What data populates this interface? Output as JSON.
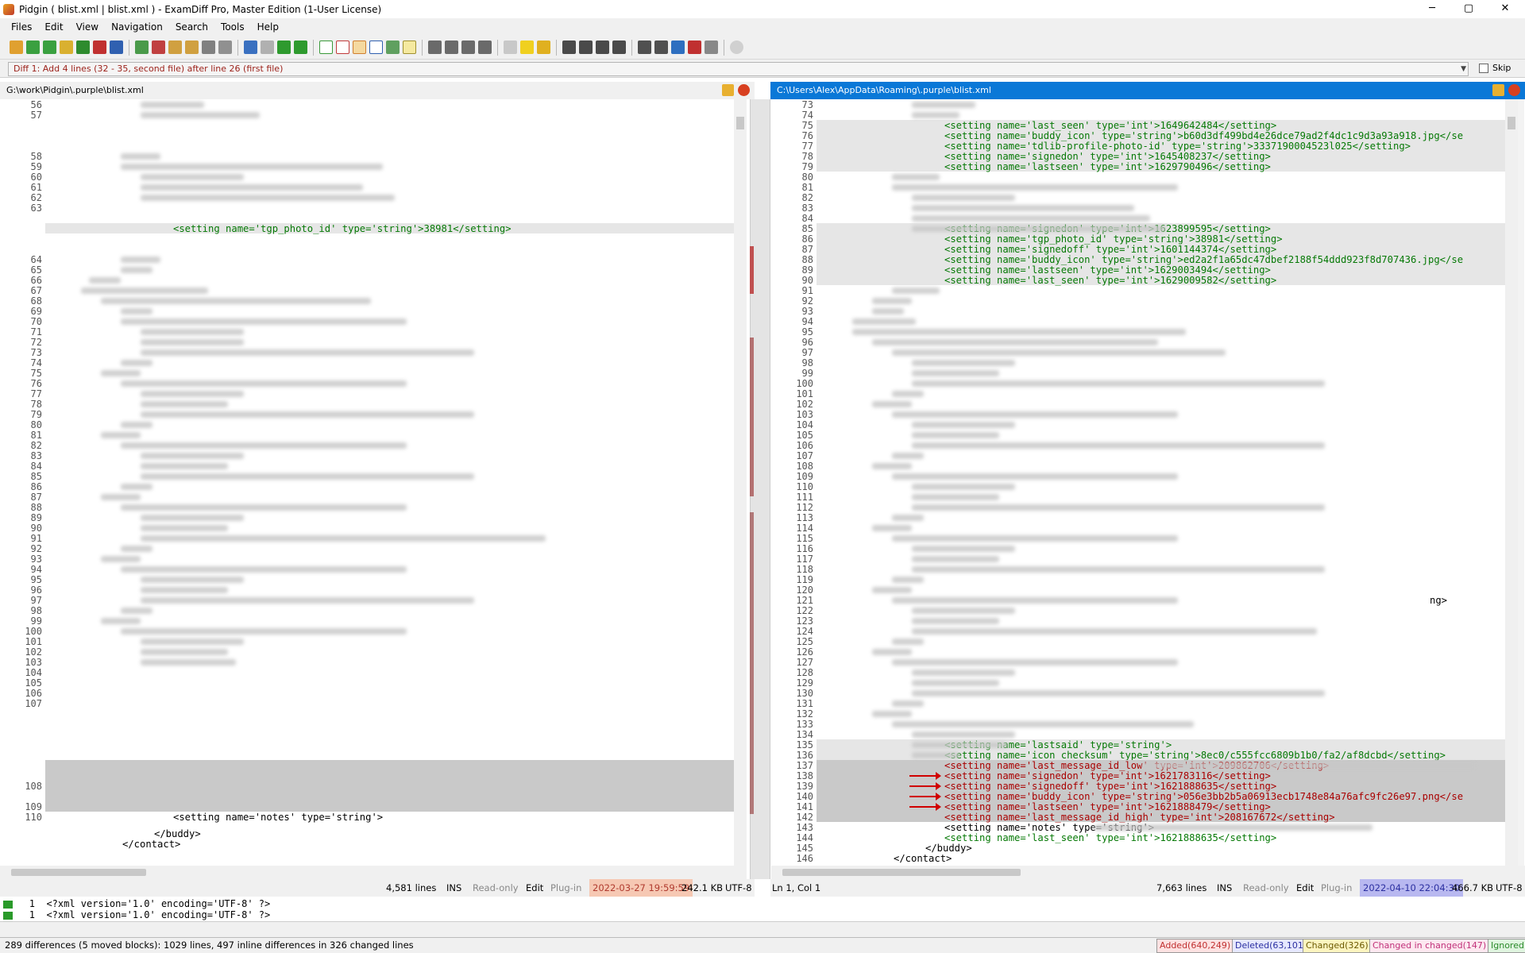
{
  "window": {
    "title": "Pidgin ( blist.xml  |  blist.xml ) - ExamDiff Pro, Master Edition (1-User License)",
    "controls": [
      "─",
      "▢",
      "✕"
    ]
  },
  "menu": [
    "Files",
    "Edit",
    "View",
    "Navigation",
    "Search",
    "Tools",
    "Help"
  ],
  "diffbar": {
    "current": "Diff 1: Add 4 lines (32 - 35, second file) after line 26 (first file)",
    "skip_label": "Skip"
  },
  "left": {
    "path": "G:\\work\\Pidgin\\.purple\\blist.xml",
    "numbers": [
      "56",
      "57",
      "",
      "",
      "",
      "58",
      "59",
      "60",
      "61",
      "62",
      "63",
      "",
      "",
      "",
      "",
      "64",
      "65",
      "66",
      "67",
      "68",
      "69",
      "70",
      "71",
      "72",
      "73",
      "74",
      "75",
      "76",
      "77",
      "78",
      "79",
      "80",
      "81",
      "82",
      "83",
      "84",
      "85",
      "86",
      "87",
      "88",
      "89",
      "90",
      "91",
      "92",
      "93",
      "94",
      "95",
      "96",
      "97",
      "98",
      "99",
      "100",
      "101",
      "102",
      "103",
      "104",
      "105",
      "106",
      "107",
      "",
      "",
      "",
      "",
      "",
      "",
      "",
      "108",
      "",
      "109",
      "110"
    ],
    "line63": "<setting name='tgp_photo_id' type='string'>38981</setting>",
    "line108": "<setting name='notes' type='string'>",
    "line109": "</buddy>",
    "line110": "</contact>",
    "status": {
      "lines": "4,581 lines",
      "ins": "INS",
      "ro": "Read-only",
      "edit": "Edit",
      "plugin": "Plug-in",
      "date": "2022-03-27 19:59:59",
      "size": "242.1 KB",
      "enc": "UTF-8"
    }
  },
  "right": {
    "path": "C:\\Users\\Alex\\AppData\\Roaming\\.purple\\blist.xml",
    "numbers": [
      "73",
      "74",
      "75",
      "76",
      "77",
      "78",
      "79",
      "80",
      "81",
      "82",
      "83",
      "84",
      "85",
      "86",
      "87",
      "88",
      "89",
      "90",
      "91",
      "92",
      "93",
      "94",
      "95",
      "96",
      "97",
      "98",
      "99",
      "100",
      "101",
      "102",
      "103",
      "104",
      "105",
      "106",
      "107",
      "108",
      "109",
      "110",
      "111",
      "112",
      "113",
      "114",
      "115",
      "116",
      "117",
      "118",
      "119",
      "120",
      "121",
      "122",
      "123",
      "124",
      "125",
      "126",
      "127",
      "128",
      "129",
      "130",
      "131",
      "132",
      "133",
      "134",
      "135",
      "136",
      "137",
      "138",
      "139",
      "140",
      "141",
      "142",
      "143",
      "144",
      "145",
      "146"
    ],
    "l75": "<setting name='last_seen' type='int'>1649642484</setting>",
    "l76": "<setting name='buddy_icon' type='string'>b60d3df499bd4e26dce79ad2f4dc1c9d3a93a918.jpg</se",
    "l77": "<setting name='tdlib-profile-photo-id' type='string'>3337190004523l025</setting>",
    "l78": "<setting name='signedon' type='int'>1645408237</setting>",
    "l79": "<setting name='lastseen' type='int'>1629790496</setting>",
    "l85": "<setting name='signedon' type='int'>1623899595</setting>",
    "l86": "<setting name='tgp_photo_id' type='string'>38981</setting>",
    "l87": "<setting name='signedoff' type='int'>1601144374</setting>",
    "l88": "<setting name='buddy_icon' type='string'>ed2a2f1a65dc47dbef2188f54ddd923f8d707436.jpg</se",
    "l89": "<setting name='lastseen' type='int'>1629003494</setting>",
    "l90": "<setting name='last_seen' type='int'>1629009582</setting>",
    "l121": "ng>",
    "l135": "<setting name='lastsaid' type='string'>",
    "l136": "<setting name='icon_checksum' type='string'>8ec0/c555fcc6809b1b0/fa2/af8dcbd</setting>",
    "l137": "<setting name='last_message_id_low' type='int'>209862706</setting>",
    "l138": "<setting name='signedon' type='int'>1621783116</setting>",
    "l139": "<setting name='signedoff' type='int'>1621888635</setting>",
    "l140": "<setting name='buddy_icon' type='string'>056e3bb2b5a06913ecb1748e84a76afc9fc26e97.png</se",
    "l141": "<setting name='lastseen' type='int'>1621888479</setting>",
    "l142": "<setting name='last_message_id_high' type='int'>208167672</setting>",
    "l143": "<setting name='notes' type='string'>",
    "l144": "<setting name='last_seen' type='int'>1621888635</setting>",
    "l145": "</buddy>",
    "l146": "</contact>",
    "status": {
      "pos": "Ln 1, Col 1",
      "lines": "7,663 lines",
      "ins": "INS",
      "ro": "Read-only",
      "edit": "Edit",
      "plugin": "Plug-in",
      "date": "2022-04-10 22:04:30",
      "size": "466.7 KB",
      "enc": "UTF-8"
    }
  },
  "bottom": {
    "num1": "1",
    "line1": "<?xml version='1.0' encoding='UTF-8' ?>",
    "num2": "1",
    "line2": "<?xml version='1.0' encoding='UTF-8' ?>"
  },
  "footer": {
    "summary": "289 differences (5 moved blocks): 1029 lines, 497 inline differences in 326 changed lines",
    "added": "Added(640,249)",
    "deleted": "Deleted(63,101)",
    "changed": "Changed(326)",
    "changed_in_changed": "Changed in changed(147)",
    "ignored": "Ignored"
  },
  "colors": {
    "added": "#067906",
    "changed_text": "#a90000",
    "header_active": "#0a78d7"
  }
}
